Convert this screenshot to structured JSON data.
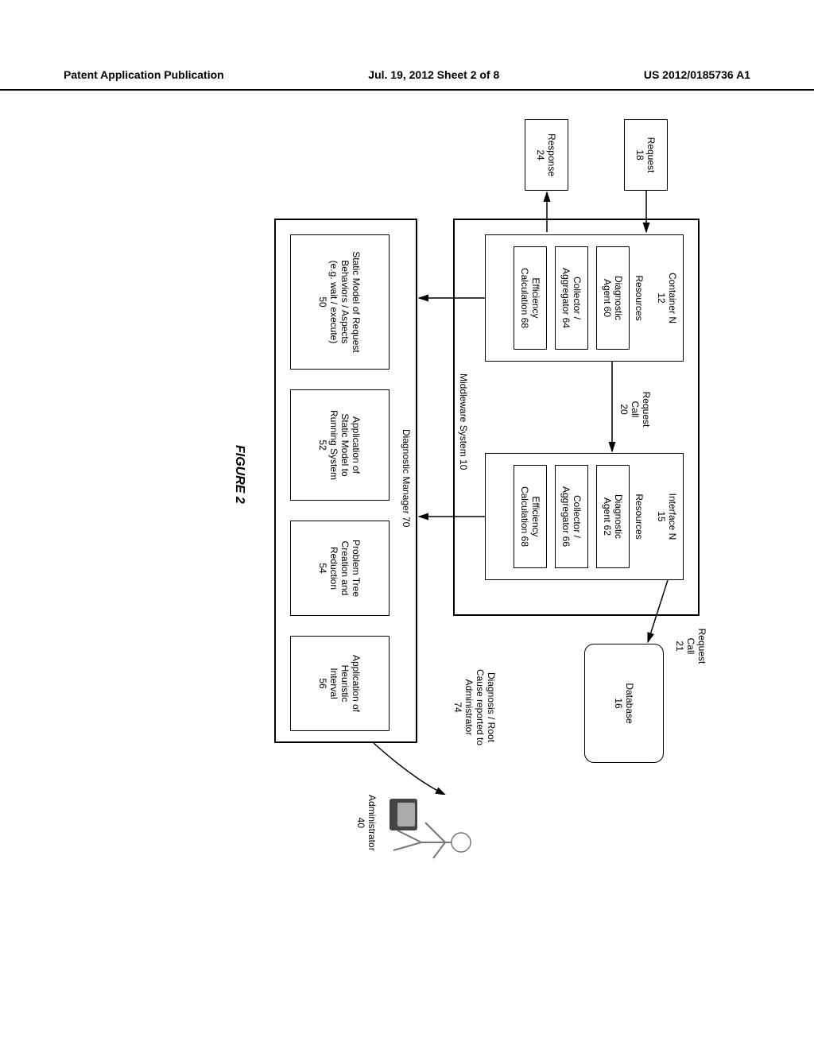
{
  "header": {
    "left": "Patent Application Publication",
    "center": "Jul. 19, 2012  Sheet 2 of 8",
    "right": "US 2012/0185736 A1"
  },
  "boxes": {
    "request": {
      "line1": "Request",
      "line2": "18"
    },
    "response": {
      "line1": "Response",
      "line2": "24"
    },
    "middleware_label": "Middleware System 10",
    "container": {
      "line1": "Container N",
      "line2": "12"
    },
    "container_resources": "Resources",
    "container_agent": {
      "line1": "Diagnostic",
      "line2": "Agent 60"
    },
    "container_collector": {
      "line1": "Collector /",
      "line2": "Aggregator 64"
    },
    "container_efficiency": {
      "line1": "Efficiency",
      "line2": "Calculation 68"
    },
    "request_call_20": {
      "line1": "Request",
      "line2": "Call",
      "line3": "20"
    },
    "interface": {
      "line1": "Interface N",
      "line2": "15"
    },
    "interface_resources": "Resources",
    "interface_agent": {
      "line1": "Diagnostic",
      "line2": "Agent 62"
    },
    "interface_collector": {
      "line1": "Collector /",
      "line2": "Aggregator 66"
    },
    "interface_efficiency": {
      "line1": "Efficiency",
      "line2": "Calculation 68"
    },
    "request_call_21": {
      "line1": "Request",
      "line2": "Call",
      "line3": "21"
    },
    "database": {
      "line1": "Database",
      "line2": "16"
    },
    "diag_manager_label": "Diagnostic Manager 70",
    "static_model": {
      "line1": "Static Model of Request",
      "line2": "Behaviors / Aspects",
      "line3": "(e.g. wait / execute)",
      "line4": "50"
    },
    "application_static": {
      "line1": "Application of",
      "line2": "Static Model to",
      "line3": "Running System",
      "line4": "52"
    },
    "problem_tree": {
      "line1": "Problem Tree",
      "line2": "Creation and",
      "line3": "Reduction",
      "line4": "54"
    },
    "heuristic": {
      "line1": "Application of",
      "line2": "Heuristic",
      "line3": "Interval",
      "line4": "56"
    },
    "diagnosis": {
      "line1": "Diagnosis / Root",
      "line2": "Cause reported to",
      "line3": "Administrator",
      "line4": "74"
    },
    "administrator": "Administrator 40"
  },
  "figure": "FIGURE 2"
}
